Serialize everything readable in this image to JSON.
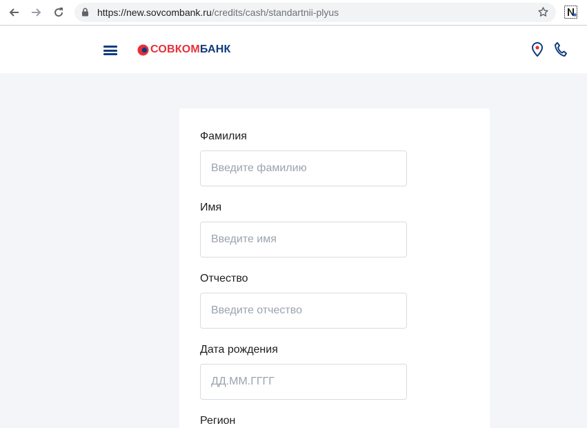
{
  "browser": {
    "url_host": "https://new.sovcombank.ru",
    "url_path": "/credits/cash/standartnii-plyus"
  },
  "header": {
    "logo_red": "СОВКОМ",
    "logo_blue": "БАНК"
  },
  "form": {
    "fields": [
      {
        "label": "Фамилия",
        "placeholder": "Введите фамилию",
        "value": ""
      },
      {
        "label": "Имя",
        "placeholder": "Введите имя",
        "value": ""
      },
      {
        "label": "Отчество",
        "placeholder": "Введите отчество",
        "value": ""
      },
      {
        "label": "Дата рождения",
        "placeholder": "ДД.ММ.ГГГГ",
        "value": ""
      },
      {
        "label": "Регион"
      }
    ]
  },
  "colors": {
    "brand_red": "#e5313a",
    "brand_blue": "#0f3b7d",
    "page_bg": "#f3f5f9"
  },
  "icons": [
    "back-arrow-icon",
    "forward-arrow-icon",
    "reload-icon",
    "lock-icon",
    "star-icon",
    "extension-n-icon",
    "menu-icon",
    "location-pin-icon",
    "phone-icon"
  ]
}
